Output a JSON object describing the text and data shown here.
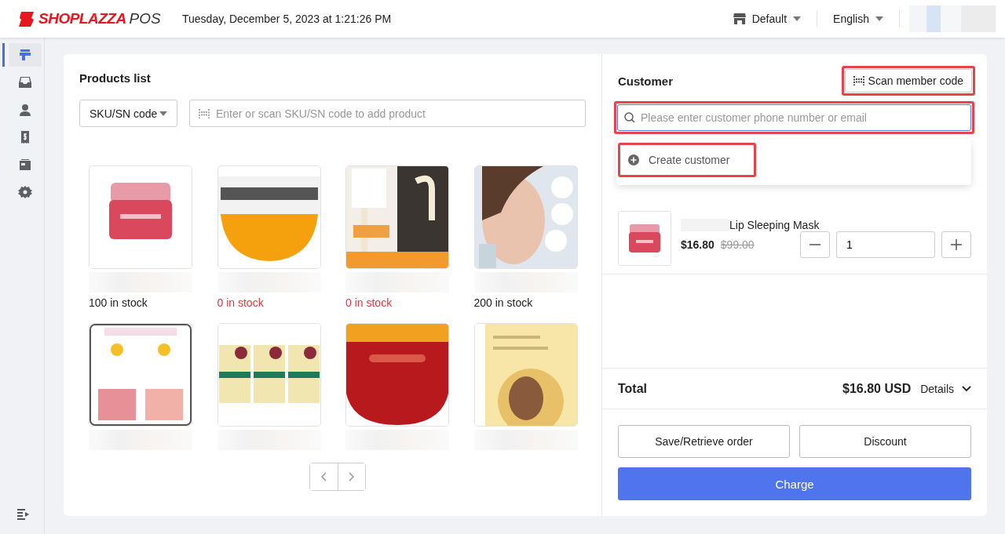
{
  "header": {
    "brand": "SHOPLAZZA",
    "product": "POS",
    "datetime": "Tuesday, December 5, 2023 at 1:21:26 PM",
    "store": "Default",
    "language": "English"
  },
  "sidebar": {
    "items": [
      {
        "kind": "register",
        "selected": true
      },
      {
        "kind": "inbox",
        "selected": false
      },
      {
        "kind": "person",
        "selected": false
      },
      {
        "kind": "receipt",
        "selected": false
      },
      {
        "kind": "box",
        "selected": false
      },
      {
        "kind": "gear",
        "selected": false
      }
    ]
  },
  "products": {
    "title": "Products list",
    "search_type": "SKU/SN code",
    "placeholder": "Enter or scan SKU/SN code to add product",
    "items": [
      {
        "kind": "picture",
        "stock": "100 in stock",
        "out_of_stock": false
      },
      {
        "kind": "picture",
        "stock": "0 in stock",
        "out_of_stock": true
      },
      {
        "kind": "picture",
        "stock": "0 in stock",
        "out_of_stock": true
      },
      {
        "kind": "picture",
        "stock": "200 in stock",
        "out_of_stock": false
      },
      {
        "kind": "picture"
      },
      {
        "kind": "picture"
      },
      {
        "kind": "picture"
      },
      {
        "kind": "picture"
      }
    ]
  },
  "customer": {
    "title": "Customer",
    "scan_button": "Scan member code",
    "scan_highlighted": true,
    "placeholder": "Please enter customer phone number or email",
    "search_highlighted": true,
    "menu": {
      "create": "Create customer",
      "create_highlighted": true
    }
  },
  "cart": {
    "items": [
      {
        "name": "Lip Sleeping Mask",
        "price": "$16.80",
        "original_price": "$99.00",
        "quantity": "1"
      }
    ]
  },
  "summary": {
    "total_label": "Total",
    "total": "$16.80 USD",
    "details": "Details",
    "expanded": false
  },
  "actions": {
    "save": "Save/Retrieve order",
    "discount": "Discount",
    "charge": "Charge"
  }
}
